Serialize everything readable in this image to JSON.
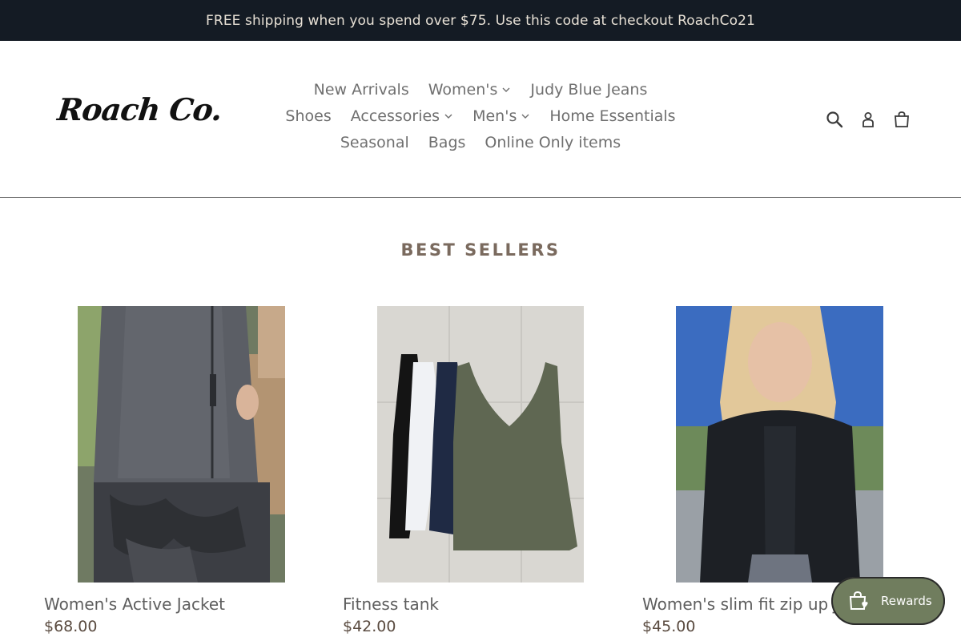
{
  "announcement": {
    "text": "FREE shipping when you spend over $75. Use this code at checkout RoachCo21"
  },
  "logo": {
    "text": "Roach Co."
  },
  "nav": {
    "items": [
      {
        "label": "New Arrivals",
        "dropdown": false
      },
      {
        "label": "Women's",
        "dropdown": true
      },
      {
        "label": "Judy Blue Jeans",
        "dropdown": false
      },
      {
        "label": "Shoes",
        "dropdown": false
      },
      {
        "label": "Accessories",
        "dropdown": true
      },
      {
        "label": "Men's",
        "dropdown": true
      },
      {
        "label": "Home Essentials",
        "dropdown": false
      },
      {
        "label": "Seasonal",
        "dropdown": false
      },
      {
        "label": "Bags",
        "dropdown": false
      },
      {
        "label": "Online Only items",
        "dropdown": false
      }
    ]
  },
  "header_icons": [
    "search-icon",
    "account-icon",
    "cart-icon"
  ],
  "section": {
    "title": "BEST SELLERS"
  },
  "products": [
    {
      "name": "Women's Active Jacket",
      "price": "$68.00"
    },
    {
      "name": "Fitness tank",
      "price": "$42.00"
    },
    {
      "name": "Women's slim fit zip up Jacket",
      "price": "$45.00"
    }
  ],
  "rewards": {
    "label": "Rewards"
  },
  "colors": {
    "announcement_bg": "#141b24",
    "rewards_bg": "#707d5e",
    "title": "#7a6a5e"
  }
}
